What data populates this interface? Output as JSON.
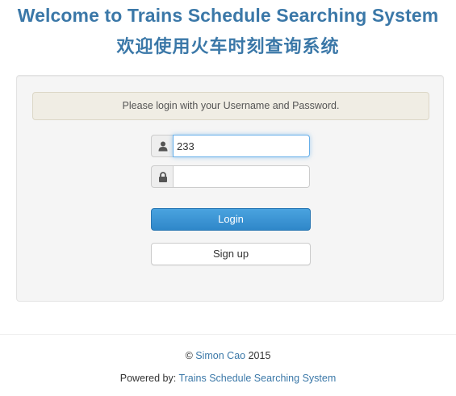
{
  "header": {
    "title_en": "Welcome to Trains Schedule Searching System",
    "title_cn": "欢迎使用火车时刻查询系统"
  },
  "login_form": {
    "alert_text": "Please login with your Username and Password.",
    "username": {
      "value": "233",
      "icon": "user-icon"
    },
    "password": {
      "value": "",
      "icon": "lock-icon"
    },
    "login_label": "Login",
    "signup_label": "Sign up"
  },
  "footer": {
    "copyright_symbol": "©",
    "author": "Simon Cao",
    "year": "2015",
    "powered_by_label": "Powered by:",
    "powered_by_link": "Trains Schedule Searching System"
  },
  "colors": {
    "title": "#3b78a8",
    "primary_button": "#3590d2",
    "link": "#3b78a8"
  }
}
